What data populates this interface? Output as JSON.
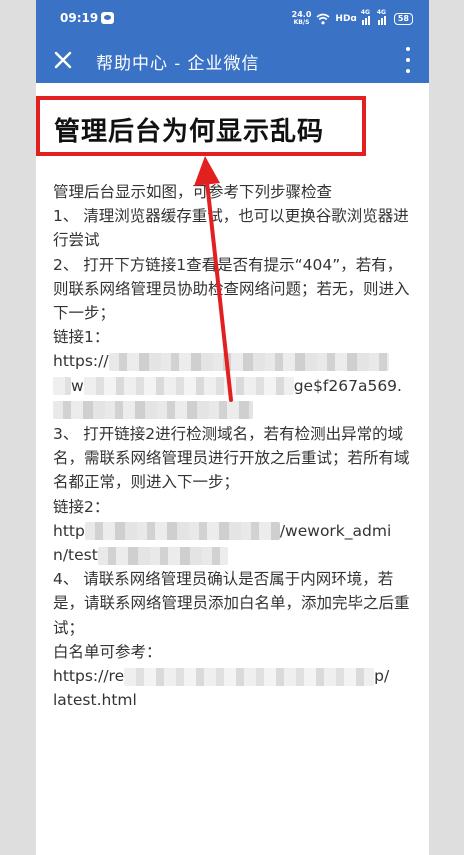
{
  "status_bar": {
    "time": "09:19",
    "speed_value": "24.0",
    "speed_unit": "KB/S",
    "hd_label": "HDɑ",
    "signal1_label": "4G",
    "signal2_label": "4G",
    "battery": "58"
  },
  "title_bar": {
    "title": "帮助中心 - 企业微信"
  },
  "article": {
    "title": "管理后台为何显示乱码",
    "intro_a": "管理后台显示如图，",
    "intro_b": "可参考下列步骤检查",
    "step1": "1、 清理浏览器缓存重试，也可以更换谷歌浏览器进行尝试",
    "step2": "2、 打开下方链接1查看是否有提示“404”，若有，则联系网络管理员协助检查网络问题；若无，则进入下一步；",
    "link1_label": "链接1：",
    "link1_start": "https://",
    "link1_mid_a": "w",
    "link1_mid_b": "ge$f267a569.",
    "step3": "3、 打开链接2进行检测域名，若有检测出异常的域名，需联系网络管理员进行开放之后重试；若所有域名都正常，则进入下一步；",
    "link2_label": "链接2：",
    "link2_start": "http",
    "link2_end": "/wework_admi",
    "link2_cont": "n/test",
    "step4": "4、 请联系网络管理员确认是否属于内网环境，若是，请联系网络管理员添加白名单，添加完毕之后重试；",
    "whitelist_label": "白名单可参考：",
    "whitelist_start": "https://re",
    "whitelist_end": "p/",
    "whitelist_file": "latest.html"
  },
  "colors": {
    "header_bg": "#3a73c6",
    "highlight_red": "#e32020"
  },
  "icons": {
    "close": "close-icon",
    "more": "more-vertical-icon",
    "wifi": "wifi-icon",
    "signal": "signal-icon",
    "battery": "battery-icon",
    "app": "app-notification-icon"
  }
}
